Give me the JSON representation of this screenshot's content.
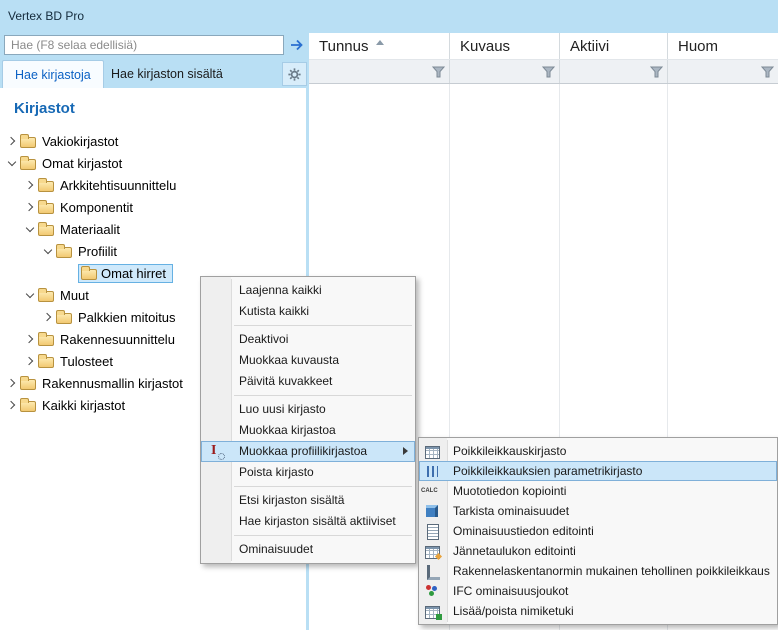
{
  "window": {
    "title": "Vertex BD Pro"
  },
  "search": {
    "placeholder": "Hae (F8 selaa edellisiä)",
    "value": ""
  },
  "tabs": [
    {
      "label": "Hae kirjastoja",
      "active": true
    },
    {
      "label": "Hae kirjaston sisältä",
      "active": false
    }
  ],
  "tree": {
    "heading": "Kirjastot",
    "items": [
      {
        "label": "Vakiokirjastot"
      },
      {
        "label": "Omat kirjastot"
      },
      {
        "label": "Arkkitehtisuunnittelu"
      },
      {
        "label": "Komponentit"
      },
      {
        "label": "Materiaalit"
      },
      {
        "label": "Profiilit"
      },
      {
        "label": "Omat hirret",
        "selected": true
      },
      {
        "label": "Muut"
      },
      {
        "label": "Palkkien mitoitus"
      },
      {
        "label": "Rakennesuunnittelu"
      },
      {
        "label": "Tulosteet"
      },
      {
        "label": "Rakennusmallin kirjastot"
      },
      {
        "label": "Kaikki kirjastot"
      }
    ]
  },
  "table": {
    "columns": [
      {
        "label": "Tunnus",
        "sorted": "asc"
      },
      {
        "label": "Kuvaus"
      },
      {
        "label": "Aktiivi"
      },
      {
        "label": "Huom"
      }
    ],
    "rows": []
  },
  "context_menu": {
    "items": [
      {
        "label": "Laajenna kaikki"
      },
      {
        "label": "Kutista kaikki"
      },
      {
        "label": "Deaktivoi"
      },
      {
        "label": "Muokkaa kuvausta"
      },
      {
        "label": "Päivitä kuvakkeet"
      },
      {
        "label": "Luo uusi kirjasto"
      },
      {
        "label": "Muokkaa kirjastoa"
      },
      {
        "label": "Muokkaa profiilikirjastoa",
        "highlighted": true,
        "has_submenu": true,
        "icon_text": "I"
      },
      {
        "label": "Poista kirjasto"
      },
      {
        "label": "Etsi kirjaston sisältä"
      },
      {
        "label": "Hae kirjaston sisältä aktiiviset"
      },
      {
        "label": "Ominaisuudet"
      }
    ]
  },
  "submenu": {
    "items": [
      {
        "label": "Poikkileikkauskirjasto",
        "icon": "table-icon"
      },
      {
        "label": "Poikkileikkauksien parametrikirjasto",
        "icon": "parameter-table-icon",
        "highlighted": true
      },
      {
        "label": "Muototiedon kopiointi",
        "icon": "calc-icon",
        "icon_text": "CALC"
      },
      {
        "label": "Tarkista ominaisuudet",
        "icon": "cube-icon"
      },
      {
        "label": "Ominaisuustiedon editointi",
        "icon": "document-icon"
      },
      {
        "label": "Jännetaulukon editointi",
        "icon": "table-edit-icon"
      },
      {
        "label": "Rakennelaskentanormin mukainen tehollinen poikkileikkaus",
        "icon": "profile-section-icon"
      },
      {
        "label": "IFC ominaisuusjoukot",
        "icon": "ifc-icon"
      },
      {
        "label": "Lisää/poista nimiketuki",
        "icon": "table-add-icon"
      }
    ]
  },
  "colors": {
    "titlebar_bg": "#b9dff4",
    "tree_selection_bg": "#cfe9fb",
    "menu_highlight_bg": "#cbe6f9",
    "active_tab_text": "#0b61c4",
    "tree_heading_text": "#1769b5",
    "folder_icon": "#f2c972"
  }
}
